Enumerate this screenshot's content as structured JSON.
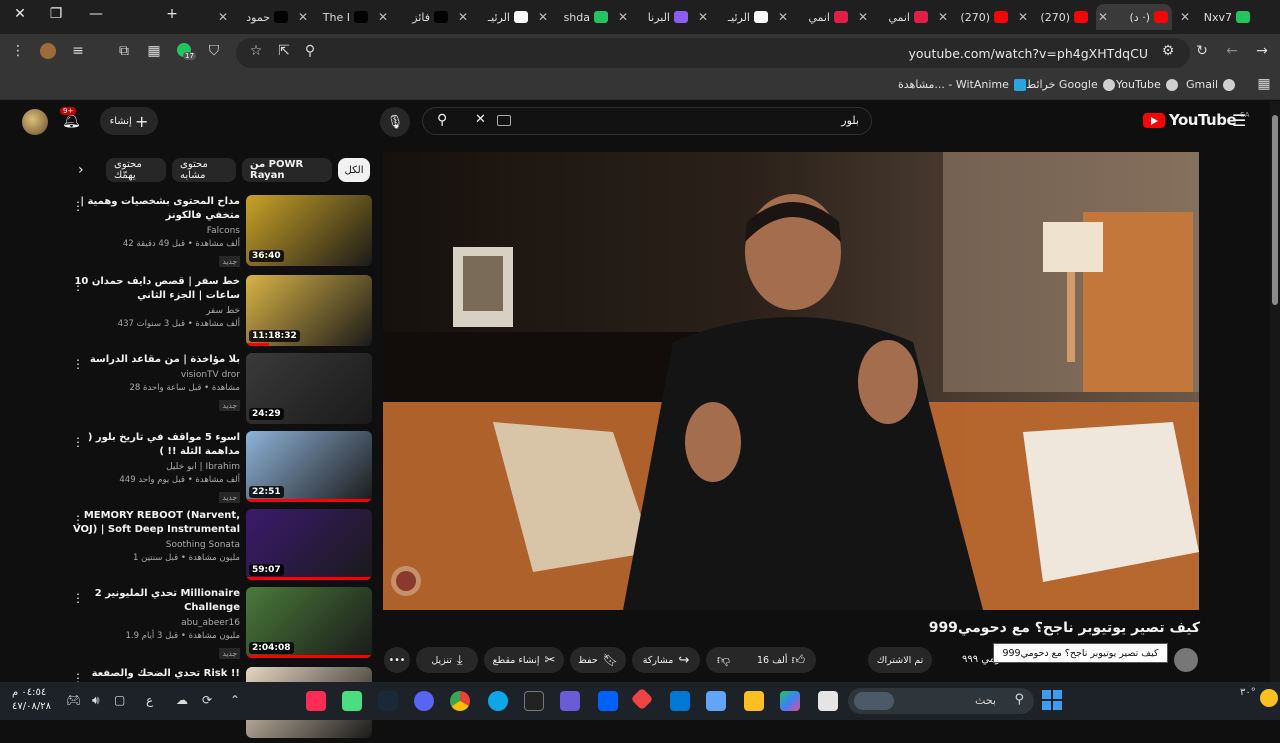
{
  "browser": {
    "tabs": [
      {
        "label": "Nxv7",
        "color": "#22c55e"
      },
      {
        "label": "(د ·)",
        "color": "#ff0000",
        "active": true
      },
      {
        "label": "(270)",
        "color": "#ff0000"
      },
      {
        "label": "(270)",
        "color": "#ff0000"
      },
      {
        "label": "انمي",
        "color": "#e11d48"
      },
      {
        "label": "انمي",
        "color": "#e11d48"
      },
      {
        "label": "الرئيـ",
        "color": "#ffffff"
      },
      {
        "label": "البرنا",
        "color": "#8b5cf6"
      },
      {
        "label": "shda",
        "color": "#22c55e"
      },
      {
        "label": "الرئيـ",
        "color": "#ffffff"
      },
      {
        "label": "فائز",
        "color": "#000000"
      },
      {
        "label": "The I",
        "color": "#000000"
      },
      {
        "label": "حمود",
        "color": "#000000"
      }
    ],
    "url": "youtube.com/watch?v=ph4gXHTdqCU",
    "extension_badge": "17",
    "bookmarks": [
      "Gmail",
      "YouTube",
      "خرائط Google",
      "مشاهدة... - WitAnime"
    ]
  },
  "youtube": {
    "logo_text": "YouTube",
    "region": "SA",
    "search_query": "بلور",
    "create_label": "إنشاء",
    "notification_count": "9+",
    "chips": [
      "الكل",
      "من POWR Rayan",
      "محتوى مشابه",
      "محتوى يهمّك"
    ],
    "recommendations": [
      {
        "title": "مداح المحتوى بشخصيات وهمية | متخفي فالكونز",
        "channel": "Falcons",
        "meta": "42 ألف مشاهدة • قبل 49 دقيقة",
        "badge": "جديد",
        "duration": "36:40",
        "progress": 0,
        "thumb": "#c9a227"
      },
      {
        "title": "خط سفر | قصص دايف حمدان 10 ساعات | الجزء الثاني",
        "channel": "خط سفر",
        "meta": "437 ألف مشاهدة • قبل 3 سنوات",
        "badge": "",
        "duration": "11:18:32",
        "progress": 0.18,
        "thumb": "#d9b347"
      },
      {
        "title": "بلا مؤاخذة | من مقاعد الدراسة",
        "channel": "visionTV dror",
        "meta": "28 مشاهدة • قبل ساعة واحدة",
        "badge": "جديد",
        "duration": "24:29",
        "progress": 0,
        "thumb": "#3a3a3a"
      },
      {
        "title": "اسوء 5 مواقف في تاريخ بلور ( مداهمة الثلة !! )",
        "channel": "ابو خليل | Ibrahim",
        "meta": "449 ألف مشاهدة • قبل يوم واحد",
        "badge": "جديد",
        "duration": "22:51",
        "progress": 1.0,
        "thumb": "#8fb3d9"
      },
      {
        "title": "MEMORY REBOOT (Narvent, VOJ) | Soft Deep Instrumental ...",
        "channel": "Soothing Sonata",
        "meta": "1 مليون مشاهدة • قبل سنتين",
        "badge": "",
        "duration": "59:07",
        "progress": 1.0,
        "thumb": "#3b1a6e"
      },
      {
        "title": "تحدي المليونير 2 Millionaire Challenge",
        "channel": "abu_abeer16",
        "meta": "1.9 مليون مشاهدة • قبل 3 أيام",
        "badge": "جديد",
        "duration": "2:04:08",
        "progress": 1.0,
        "thumb": "#4a7a3a"
      },
      {
        "title": "تحدي الضحك والصفعة Risk !!",
        "channel": "",
        "meta": "",
        "badge": "",
        "duration": "",
        "progress": 0,
        "thumb": "#e6d6c0"
      }
    ],
    "video": {
      "title": "كيف تصير يوتيوبر ناجح؟ مع دحومي999",
      "tooltip": "كيف تصير يوتيوبر ناجح؟ مع دحومي999",
      "channel": "دحومي ٩٩٩",
      "subscribed_label": "تم الاشتراك",
      "like_count": "16 ألف",
      "share_label": "مشاركة",
      "save_label": "حفظ",
      "clip_label": "إنشاء مقطع",
      "download_label": "تنزيل"
    }
  },
  "taskbar": {
    "search_placeholder": "بحث",
    "time": "٠٤:٥٤ م",
    "date": "٤٧/٠٨/٢٨",
    "language": "ع",
    "temperature": "٣٠°"
  }
}
